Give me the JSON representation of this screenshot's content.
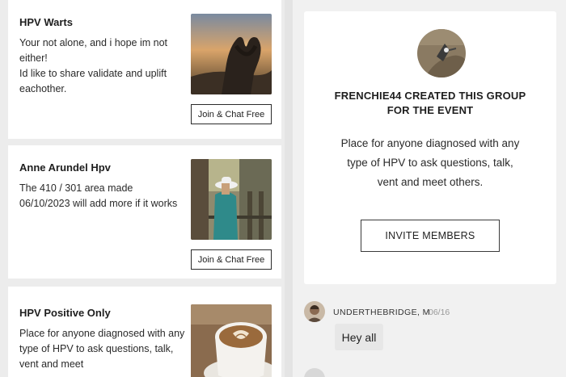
{
  "groups": [
    {
      "title": "HPV Warts",
      "description": "Your not alone, and i hope im not either!\nId like to share validate and uplift eachother.",
      "button_label": "Join & Chat Free",
      "image": "heart-hands-sunset"
    },
    {
      "title": "Anne Arundel Hpv",
      "description": "The 410 / 301 area made 06/10/2023 will add more if it works",
      "button_label": "Join & Chat Free",
      "image": "person-hat-balcony"
    },
    {
      "title": "HPV Positive Only",
      "description": "Place for anyone diagnosed with any type of HPV to ask questions, talk, vent and meet",
      "image": "latte-cup"
    }
  ],
  "event": {
    "created_by": "FRENCHIE44 CREATED THIS GROUP FOR THE EVENT",
    "description": "Place for anyone diagnosed with any type of HPV to ask questions, talk, vent and meet others.",
    "invite_label": "INVITE MEMBERS"
  },
  "message": {
    "username": "UNDERTHEBRIDGE, M",
    "date": "06/16",
    "text": "Hey all"
  },
  "colors": {
    "page_bg": "#eeeeee",
    "card_bg": "#ffffff",
    "bubble_bg": "#e7e7e7",
    "border": "#2b2b2b"
  }
}
